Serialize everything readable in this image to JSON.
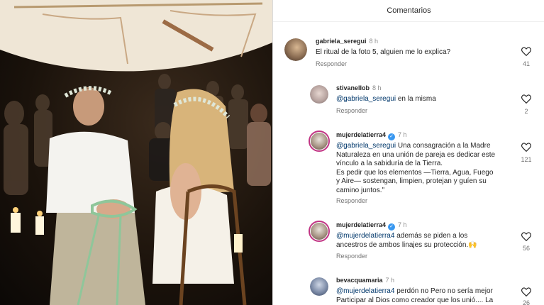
{
  "panel": {
    "title": "Comentarios"
  },
  "comments": [
    {
      "user": "gabriela_seregui",
      "time": "8 h",
      "text": "El ritual de la foto 5, alguien me lo explica?",
      "reply": "Responder",
      "likes": "41"
    },
    {
      "user": "stivanellob",
      "time": "8 h",
      "mention": "@gabriela_seregui",
      "text": " en la misma",
      "reply": "Responder",
      "likes": "2"
    },
    {
      "user": "mujerdelatierra4",
      "time": "7 h",
      "mention": "@gabriela_seregui",
      "line1": " Una consagración a la Madre",
      "line2": "Naturaleza en una unión de pareja es dedicar este",
      "line3": "vínculo a la sabiduría de la Tierra.",
      "line4": "Es pedir que los elementos —Tierra, Agua, Fuego",
      "line5": "y Aire— sostengan, limpien, protejan y guíen su",
      "line6": "camino juntos.\"",
      "reply": "Responder",
      "likes": "121"
    },
    {
      "user": "mujerdelatierra4",
      "time": "7 h",
      "mention": "@mujerdelatierra4",
      "line1": " además se piden a los",
      "line2": "ancestros  de ambos linajes su protección.🙌",
      "reply": "Responder",
      "likes": "56"
    },
    {
      "user": "bevacquamaria",
      "time": "7 h",
      "mention": "@mujerdelatierra4",
      "line1": " perdón no Pero no sería mejor",
      "line2": "Participar al Dios como creador que los unió.... La",
      "likes": "26"
    }
  ],
  "colors": {
    "accent_link": "#00376b",
    "verified": "#3897f0",
    "ring": "#c13584"
  },
  "icons": {
    "like": "heart-outline-icon",
    "verified": "verified-badge-icon"
  }
}
